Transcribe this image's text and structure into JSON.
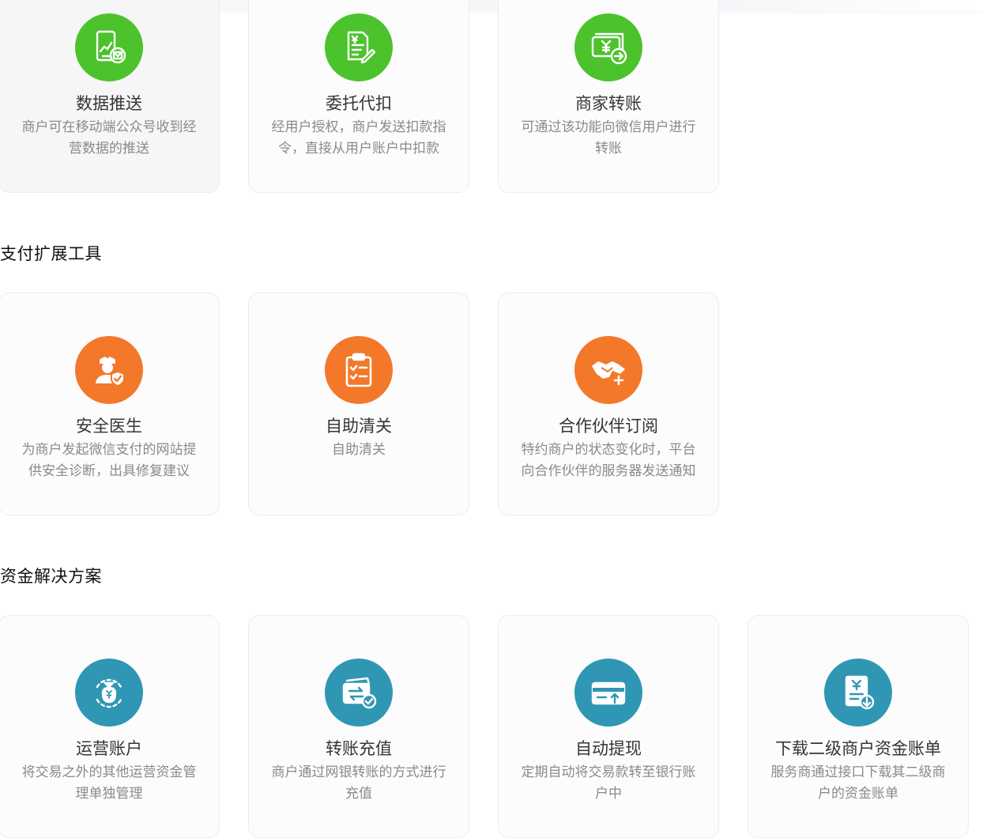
{
  "colors": {
    "green": "#4cc22c",
    "orange": "#f3782a",
    "teal": "#2f97b4"
  },
  "sections": [
    {
      "title": "",
      "cards": [
        {
          "icon": "phone-chart-mail-icon",
          "title": "数据推送",
          "desc": "商户可在移动端公众号收到经营数据的推送"
        },
        {
          "icon": "document-pen-icon",
          "title": "委托代扣",
          "desc": "经用户授权，商户发送扣款指令，直接从用户账户中扣款"
        },
        {
          "icon": "money-transfer-icon",
          "title": "商家转账",
          "desc": "可通过该功能向微信用户进行转账"
        }
      ]
    },
    {
      "title": "支付扩展工具",
      "cards": [
        {
          "icon": "doctor-shield-icon",
          "title": "安全医生",
          "desc": "为商户发起微信支付的网站提供安全诊断，出具修复建议"
        },
        {
          "icon": "clipboard-checklist-icon",
          "title": "自助清关",
          "desc": "自助清关"
        },
        {
          "icon": "handshake-plus-icon",
          "title": "合作伙伴订阅",
          "desc": "特约商户的状态变化时，平台向合作伙伴的服务器发送通知"
        }
      ]
    },
    {
      "title": "资金解决方案",
      "cards": [
        {
          "icon": "money-bag-cycle-icon",
          "title": "运营账户",
          "desc": "将交易之外的其他运营资金管理单独管理"
        },
        {
          "icon": "card-transfer-check-icon",
          "title": "转账充值",
          "desc": "商户通过网银转账的方式进行充值"
        },
        {
          "icon": "card-withdraw-icon",
          "title": "自动提现",
          "desc": "定期自动将交易款转至银行账户中"
        },
        {
          "icon": "bill-download-icon",
          "title": "下载二级商户资金账单",
          "desc": "服务商通过接口下载其二级商户的资金账单"
        }
      ]
    }
  ]
}
